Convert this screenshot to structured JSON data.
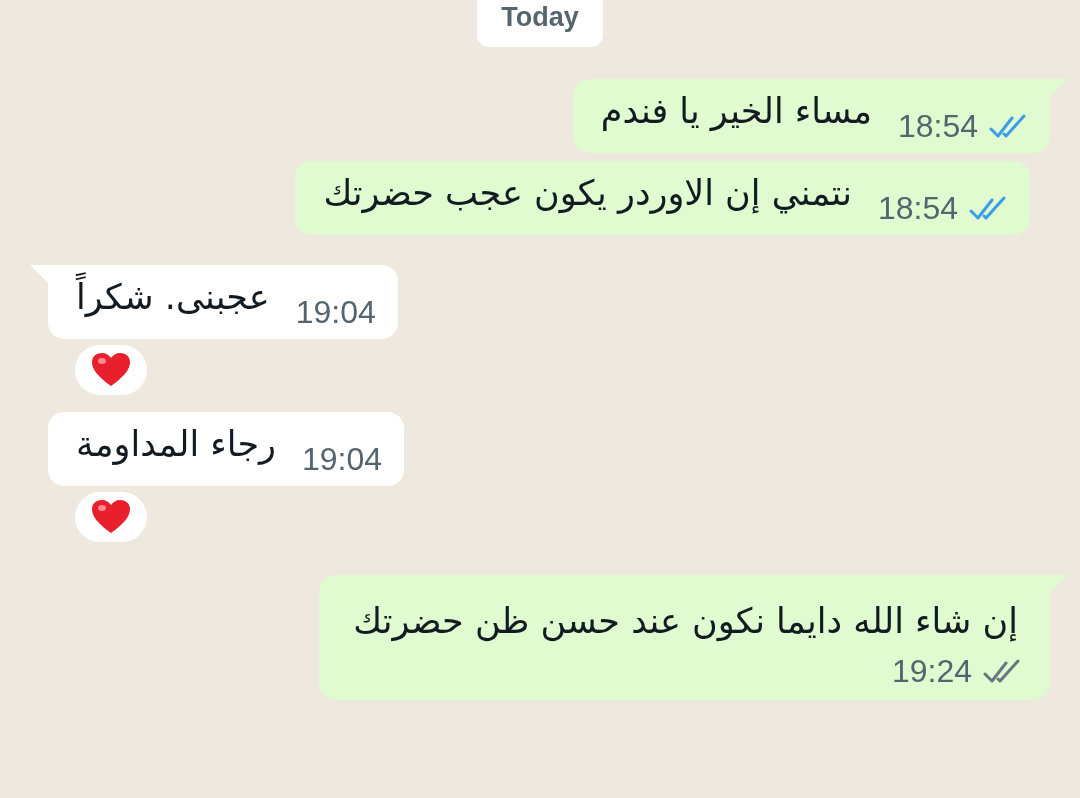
{
  "date_chip": "Today",
  "messages": [
    {
      "outgoing": true,
      "kind": "inline",
      "tail": true,
      "text": "مساء الخير يا فندم",
      "time": "18:54",
      "read": true,
      "reaction": false
    },
    {
      "outgoing": true,
      "kind": "inline",
      "tail": false,
      "text": "نتمني إن الاوردر يكون عجب حضرتك",
      "time": "18:54",
      "read": true,
      "reaction": false
    },
    {
      "outgoing": false,
      "kind": "inline",
      "tail": true,
      "text": "عجبنى. شكراً",
      "time": "19:04",
      "reaction": true
    },
    {
      "outgoing": false,
      "kind": "inline",
      "tail": false,
      "text": "رجاء المداومة",
      "time": "19:04",
      "reaction": true
    },
    {
      "outgoing": true,
      "kind": "stacked",
      "tail": true,
      "text": "إن شاء الله دايما نكون عند حسن ظن حضرتك",
      "time": "19:24",
      "read": false,
      "reaction": false
    }
  ]
}
